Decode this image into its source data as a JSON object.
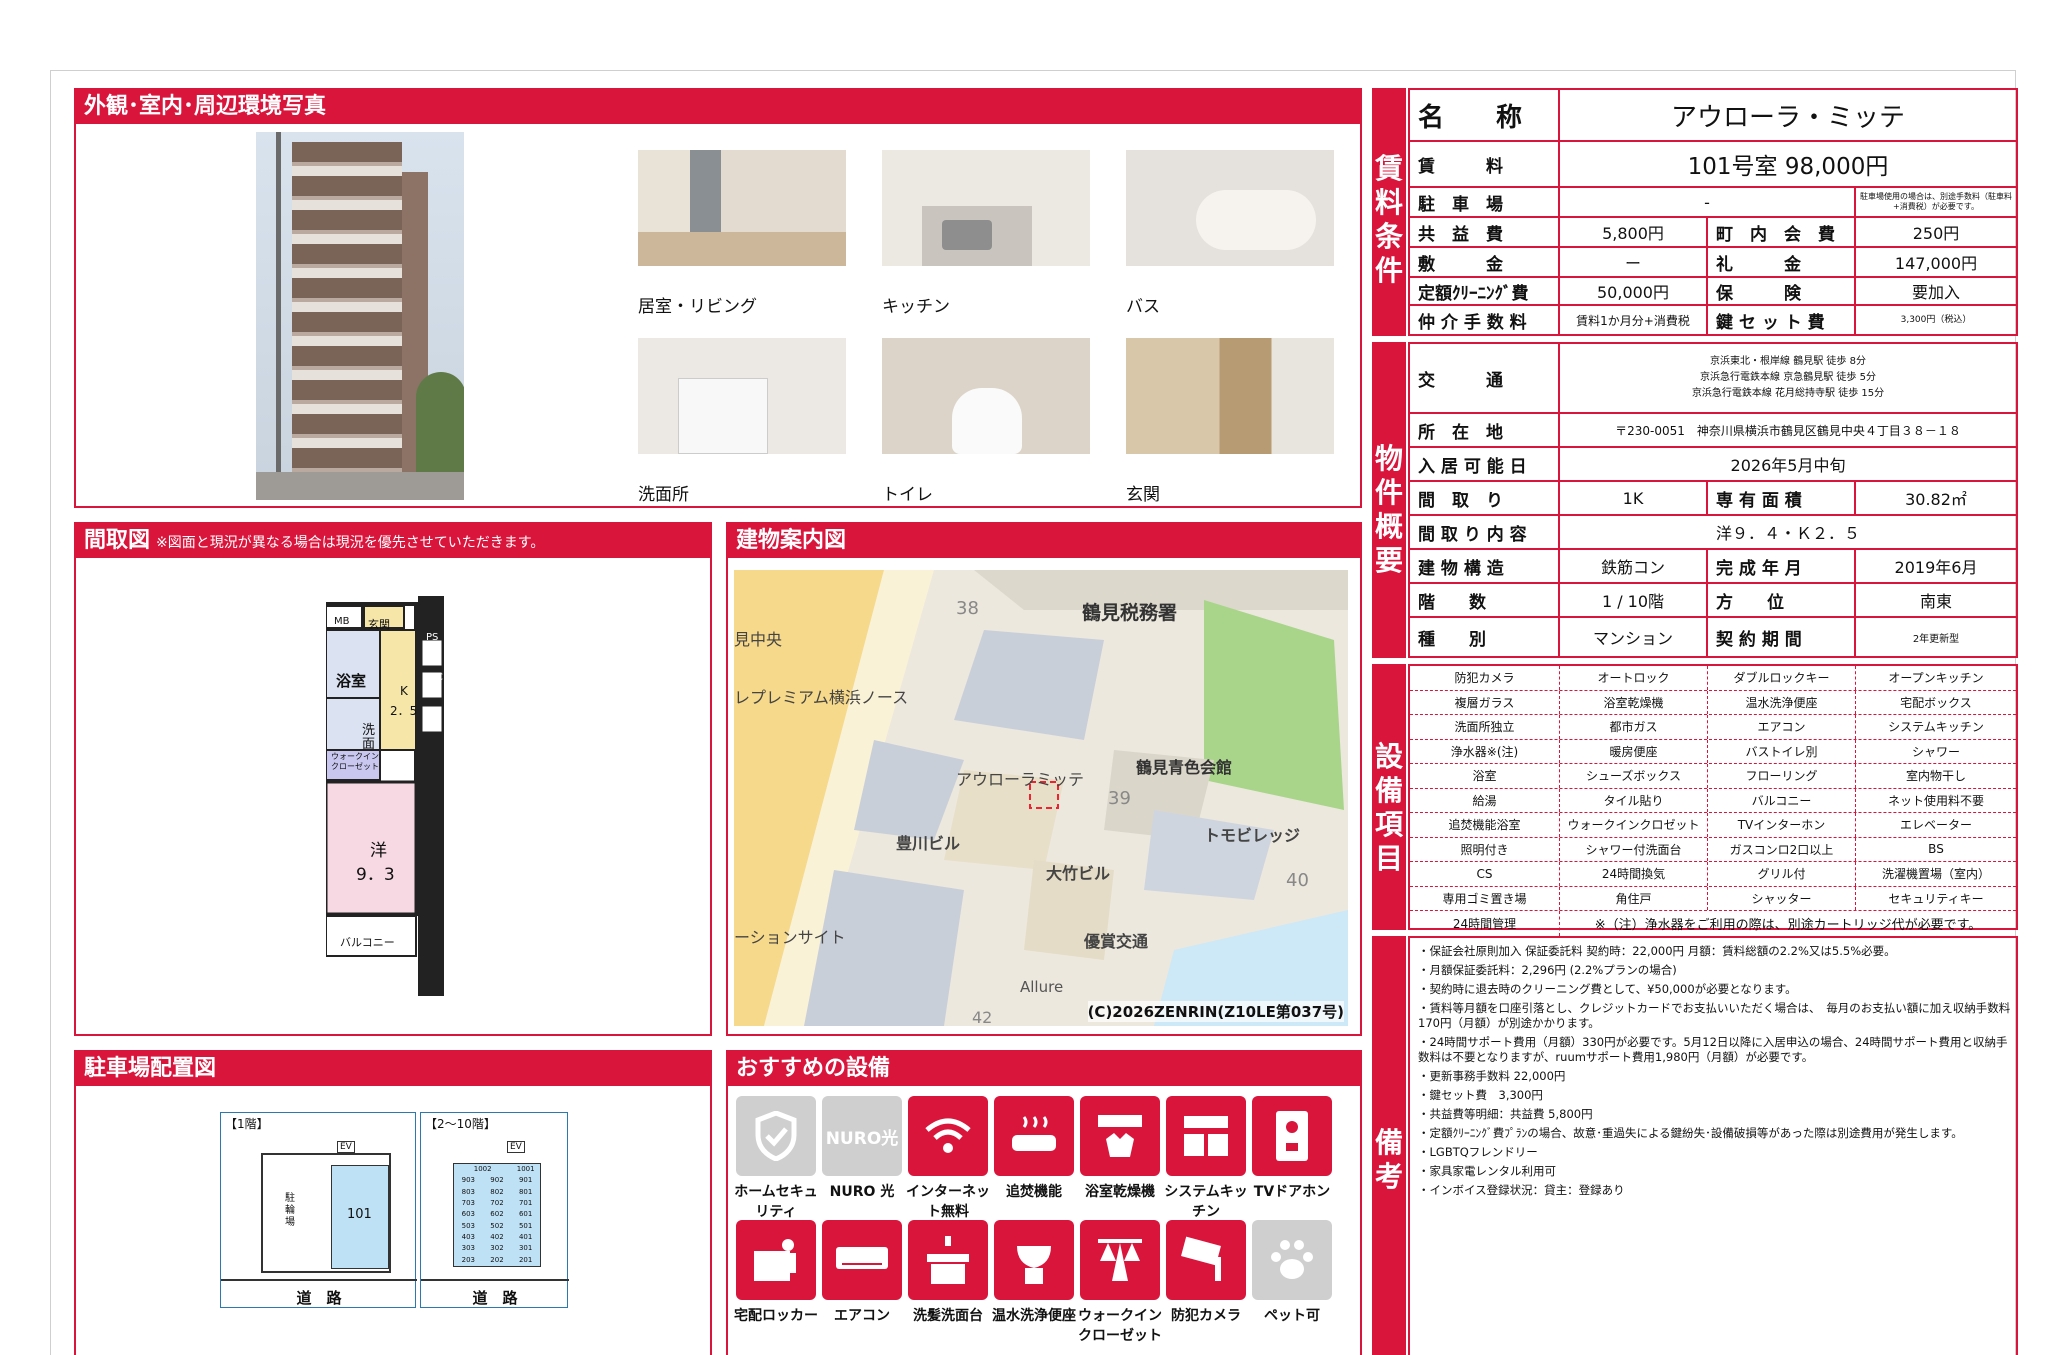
{
  "photos": {
    "title": "外観･室内･周辺環境写真",
    "captions": [
      "居室・リビング",
      "キッチン",
      "バス",
      "洗面所",
      "トイレ",
      "玄関"
    ]
  },
  "floorplan": {
    "title": "間取図",
    "note": "※図面と現況が異なる場合は現況を優先させていただきます。",
    "rooms": {
      "mb": "MB",
      "genkan": "玄関",
      "ps": "PS",
      "wc": "WC",
      "bath": "浴室",
      "k": "K",
      "k_size": "2．5",
      "wash": "洗面",
      "closet": "ウォークイン クローゼット",
      "western": "洋",
      "western_size": "9．3",
      "balcony": "バルコニー"
    }
  },
  "map": {
    "title": "建物案内図",
    "labels": [
      "鶴見税務署",
      "見中央",
      "レプレミアム横浜ノース",
      "アウローラミッテ",
      "鶴見青色会館",
      "豊川ビル",
      "トモビレッジ",
      "大竹ビル",
      "優賞交通",
      "ーションサイト",
      "Allure"
    ],
    "numbers": [
      "38",
      "39",
      "40",
      "42"
    ],
    "copyright": "(C)2026ZENRIN(Z10LE第037号)"
  },
  "parking": {
    "title": "駐車場配置図",
    "floor1": "【1階】",
    "floor2": "【2～10階】",
    "road": "道　路",
    "room101": "101",
    "parking_label": "駐輪場",
    "ev": "EV",
    "rooms_upper": [
      "1002",
      "1001",
      "903",
      "902",
      "901",
      "803",
      "802",
      "801",
      "703",
      "702",
      "701",
      "603",
      "602",
      "601",
      "503",
      "502",
      "501",
      "403",
      "402",
      "401",
      "303",
      "302",
      "301",
      "203",
      "202",
      "201"
    ]
  },
  "recommended": {
    "title": "おすすめの設備",
    "items": [
      {
        "label": "ホームセキュリティ",
        "icon": "shield-icon",
        "active": false
      },
      {
        "label": "NURO 光",
        "icon": "nuro-icon",
        "active": false
      },
      {
        "label": "インターネット無料",
        "icon": "wifi-icon",
        "active": true
      },
      {
        "label": "追焚機能",
        "icon": "bathtub-icon",
        "active": true
      },
      {
        "label": "浴室乾燥機",
        "icon": "bath-dryer-icon",
        "active": true
      },
      {
        "label": "システムキッチン",
        "icon": "kitchen-icon",
        "active": true
      },
      {
        "label": "TVドアホン",
        "icon": "intercom-icon",
        "active": true
      },
      {
        "label": "宅配ロッカー",
        "icon": "delivery-locker-icon",
        "active": true
      },
      {
        "label": "エアコン",
        "icon": "aircon-icon",
        "active": true
      },
      {
        "label": "洗髪洗面台",
        "icon": "washbasin-icon",
        "active": true
      },
      {
        "label": "温水洗浄便座",
        "icon": "toilet-icon",
        "active": true
      },
      {
        "label": "ウォークインクローゼット",
        "icon": "closet-icon",
        "active": true
      },
      {
        "label": "防犯カメラ",
        "icon": "camera-icon",
        "active": true
      },
      {
        "label": "ペット可",
        "icon": "paw-icon",
        "active": false
      }
    ]
  },
  "rental": {
    "side": "賃料条件",
    "name_label": "名　　称",
    "name": "アウローラ・ミッテ",
    "rent_label": "賃　　　料",
    "rent": "101号室 98,000円",
    "parking_label": "駐　車　場",
    "parking": "-",
    "parking_note": "駐車場使用の場合は、別途手数料（駐車料+消費税）が必要です。",
    "common_label": "共　益　費",
    "common": "5,800円",
    "town_label": "町　内　会　費",
    "town": "250円",
    "deposit_label": "敷　　　金",
    "deposit": "ー",
    "key_money_label": "礼　　　金",
    "key_money": "147,000円",
    "cleaning_label": "定額ｸﾘｰﾆﾝｸﾞ費",
    "cleaning": "50,000円",
    "insurance_label": "保　　　険",
    "insurance": "要加入",
    "broker_label": "仲 介 手 数 料",
    "broker": "賃料1か月分+消費税",
    "keyset_label": "鍵 セ ッ ト 費",
    "keyset": "3,300円（税込）"
  },
  "overview": {
    "side": "物件概要",
    "traffic_label": "交　　　通",
    "traffic": [
      "京浜東北・根岸線 鶴見駅 徒歩 8分",
      "京浜急行電鉄本線 京急鶴見駅 徒歩 5分",
      "京浜急行電鉄本線 花月総持寺駅 徒歩 15分"
    ],
    "address_label": "所　在　地",
    "address": "〒230-0051　神奈川県横浜市鶴見区鶴見中央４丁目３８－１８",
    "move_label": "入 居 可 能 日",
    "move": "2026年5月中旬",
    "layout_label": "間　取　り",
    "layout": "1K",
    "area_label": "専 有 面 積",
    "area": "30.82㎡",
    "detail_label": "間 取 り 内 容",
    "detail": "洋９．４・Ｋ２．５",
    "structure_label": "建 物 構 造",
    "structure": "鉄筋コン",
    "built_label": "完 成 年 月",
    "built": "2019年6月",
    "floor_label": "階　　数",
    "floor": "1 / 10階",
    "direction_label": "方　　位",
    "direction": "南東",
    "type_label": "種　　別",
    "type": "マンション",
    "contract_label": "契 約 期 間",
    "contract": "2年更新型"
  },
  "equipment": {
    "side": "設備項目",
    "items": [
      "防犯カメラ",
      "オートロック",
      "ダブルロックキー",
      "オープンキッチン",
      "複層ガラス",
      "浴室乾燥機",
      "温水洗浄便座",
      "宅配ボックス",
      "洗面所独立",
      "都市ガス",
      "エアコン",
      "システムキッチン",
      "浄水器※(注)",
      "暖房便座",
      "バストイレ別",
      "シャワー",
      "浴室",
      "シューズボックス",
      "フローリング",
      "室内物干し",
      "給湯",
      "タイル貼り",
      "バルコニー",
      "ネット使用料不要",
      "追焚機能浴室",
      "ウォークインクロゼット",
      "TVインターホン",
      "エレベーター",
      "照明付き",
      "シャワー付洗面台",
      "ガスコンロ2口以上",
      "BS",
      "CS",
      "24時間換気",
      "グリル付",
      "洗濯機置場（室内）",
      "専用ゴミ置き場",
      "角住戸",
      "シャッター",
      "セキュリティキー"
    ],
    "last_item": "24時間管理",
    "last_note": "※（注）浄水器をご利用の際は、別途カートリッジ代が必要です。"
  },
  "remarks": {
    "side": "備考",
    "lines": [
      "・保証会社原則加入 保証委託料 契約時：22,000円 月額：賃料総額の2.2%又は5.5%必要。",
      "・月額保証委託料：2,296円 (2.2%プランの場合)",
      "・契約時に退去時のクリーニング費として、¥50,000が必要となります。",
      "・賃料等月額を口座引落とし、クレジットカードでお支払いいただく場合は、　毎月のお支払い額に加え収納手数料 170円（月額）が別途かかります。",
      "・24時間サポート費用（月額）330円が必要です。5月12日以降に入居申込の場合、24時間サポート費用と収納手数料は不要となりますが、ruumサポート費用1,980円（月額）が必要です。",
      "・更新事務手数料 22,000円",
      "・鍵セット費　3,300円",
      "・共益費等明細：共益費 5,800円",
      "・定額ｸﾘｰﾆﾝｸﾞ費ﾌﾟﾗﾝの場合、故意･重過失による鍵紛失･設備破損等があった際は別途費用が発生します。",
      "・LGBTQフレンドリー",
      "・家具家電レンタル利用可",
      "・インボイス登録状況：貸主：登録あり"
    ]
  },
  "colors": {
    "accent": "#d9153c"
  }
}
